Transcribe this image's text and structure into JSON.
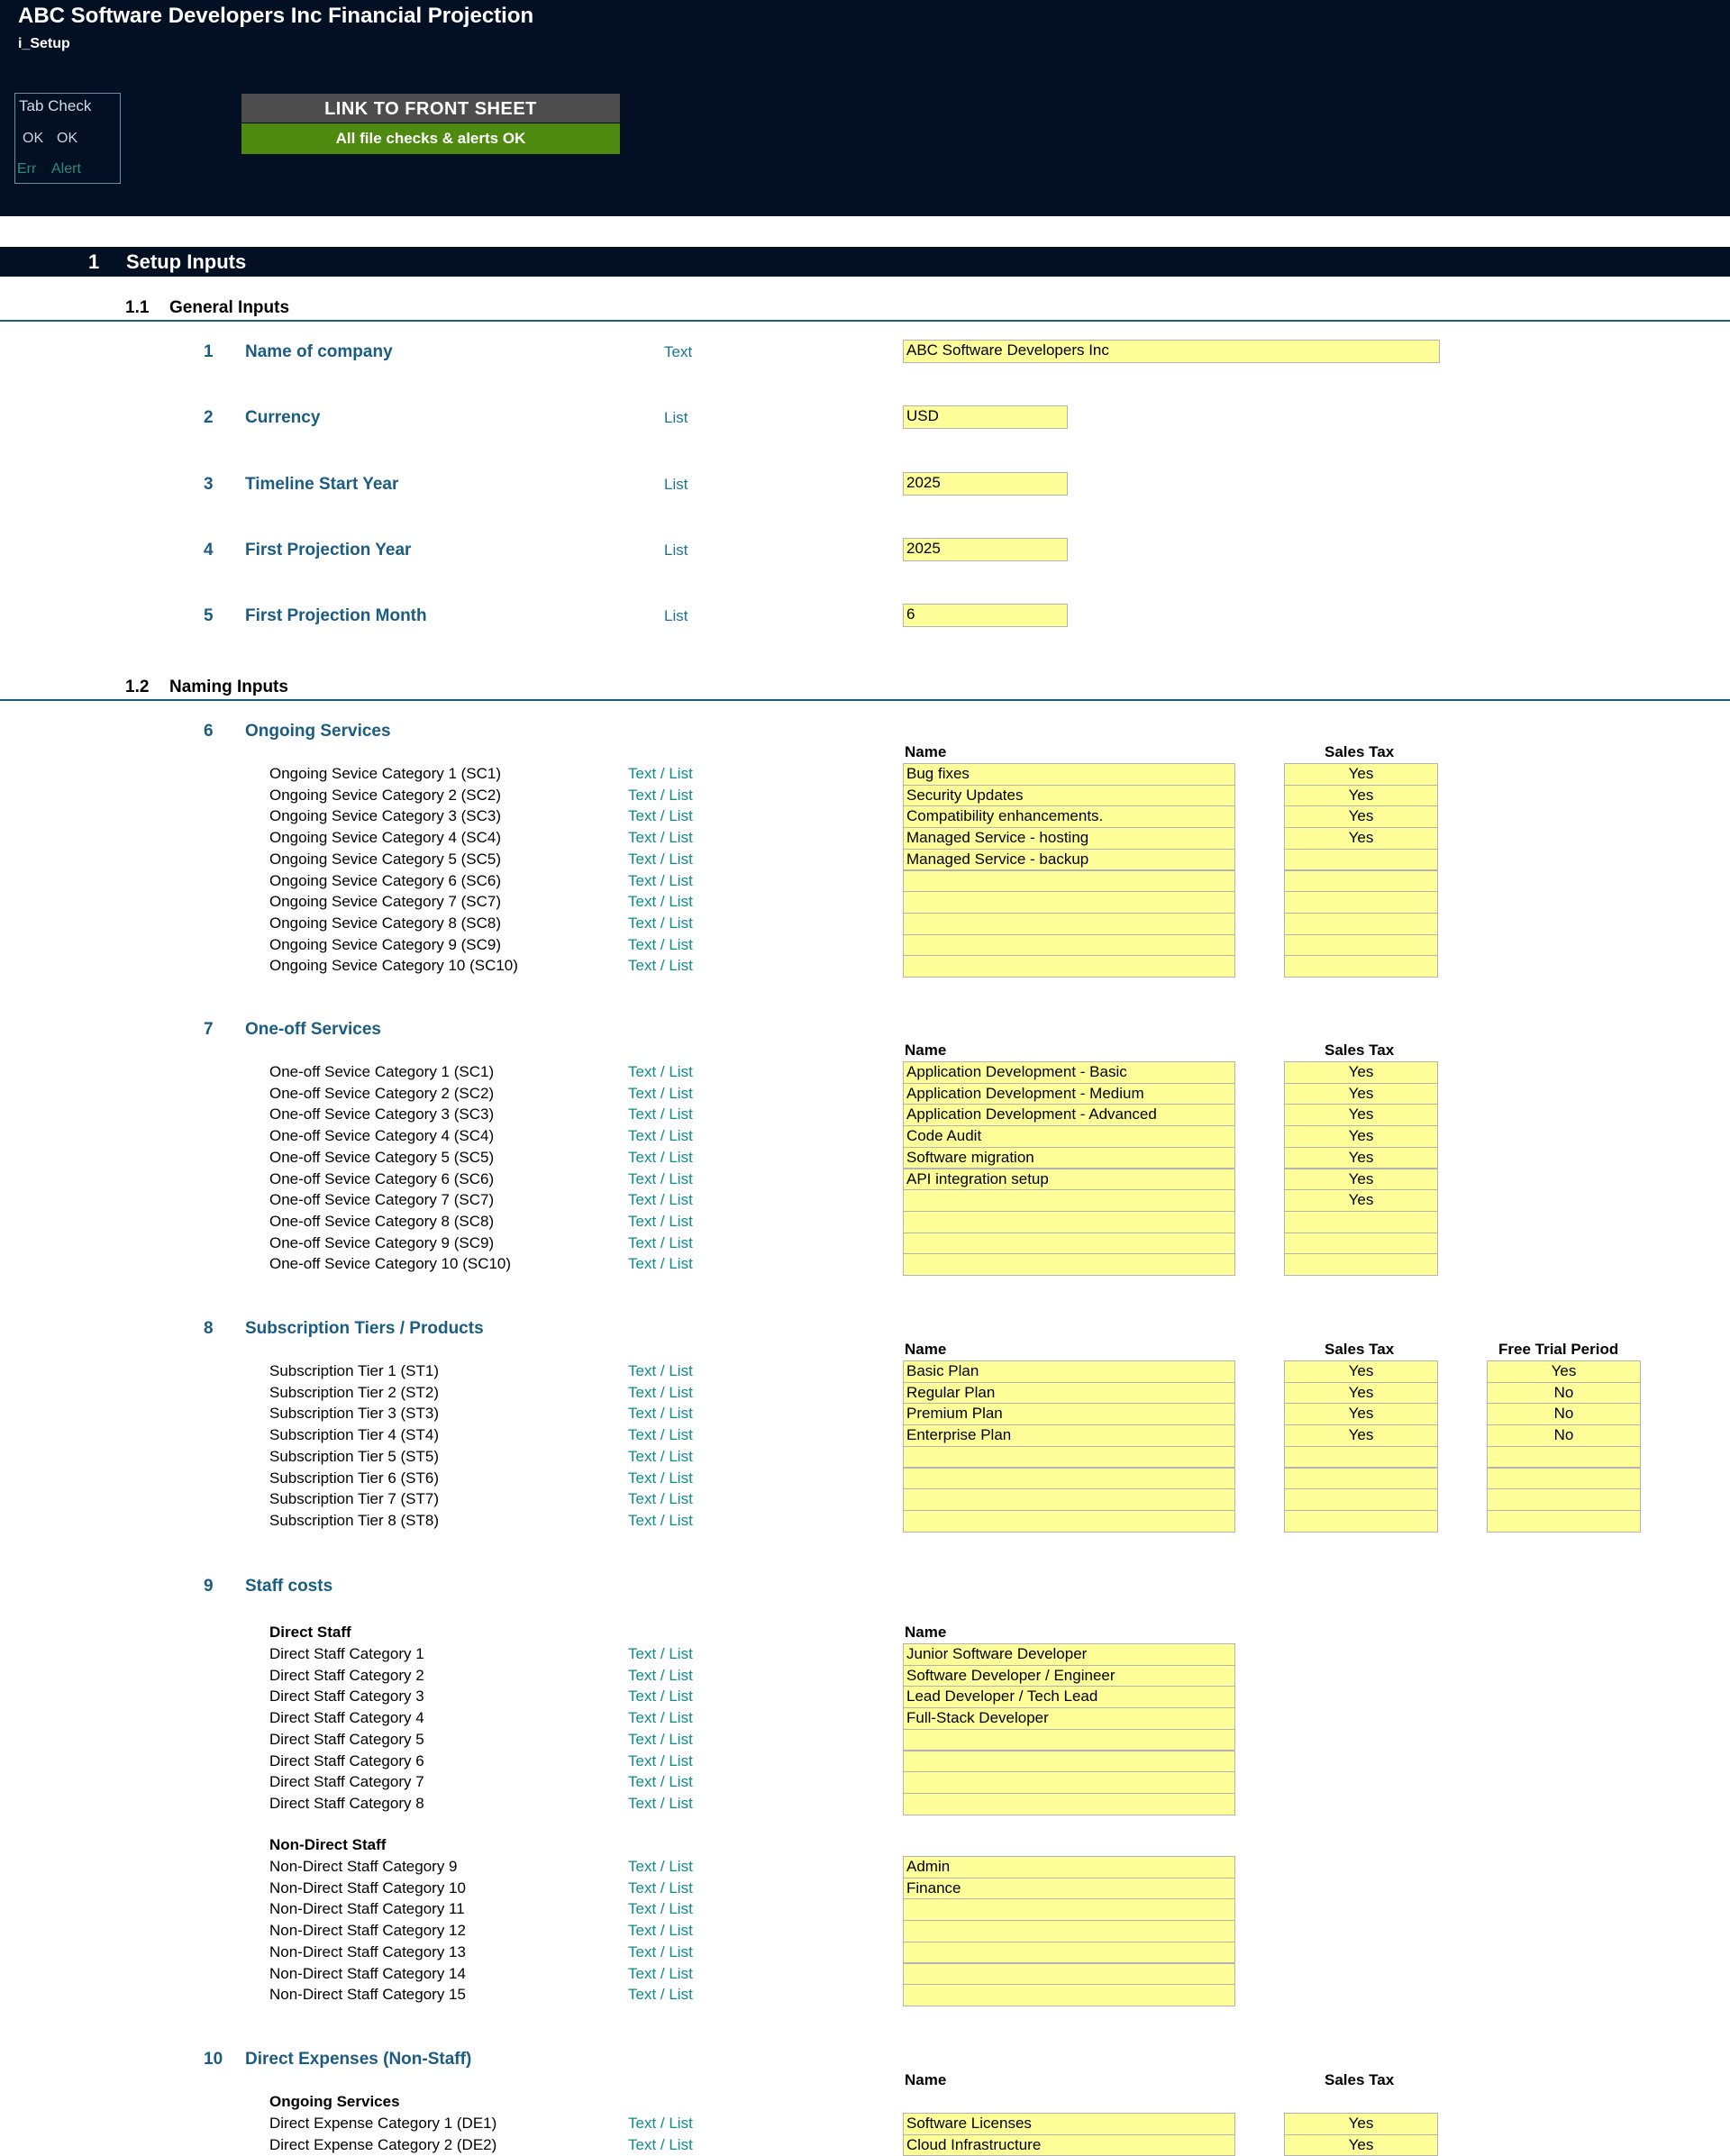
{
  "header": {
    "title": "ABC Software Developers Inc Financial Projection",
    "sheet": "i_Setup",
    "tab_check": {
      "title": "Tab Check",
      "ok1": "OK",
      "ok2": "OK",
      "err": "Err",
      "alert": "Alert"
    },
    "link_button": "LINK TO FRONT SHEET",
    "status": "All file checks & alerts OK"
  },
  "section": {
    "number": "1",
    "title": "Setup Inputs"
  },
  "general": {
    "number": "1.1",
    "title": "General Inputs",
    "items": [
      {
        "num": "1",
        "label": "Name of company",
        "type": "Text",
        "value": "ABC Software Developers Inc"
      },
      {
        "num": "2",
        "label": "Currency",
        "type": "List",
        "value": "USD"
      },
      {
        "num": "3",
        "label": "Timeline Start Year",
        "type": "List",
        "value": "2025"
      },
      {
        "num": "4",
        "label": "First Projection Year",
        "type": "List",
        "value": "2025"
      },
      {
        "num": "5",
        "label": "First Projection Month",
        "type": "List",
        "value": "6"
      }
    ]
  },
  "naming": {
    "number": "1.2",
    "title": "Naming Inputs"
  },
  "text_list": "Text / List",
  "col_name": "Name",
  "col_sales_tax": "Sales Tax",
  "col_free_trial": "Free Trial Period",
  "ongoing": {
    "num": "6",
    "title": "Ongoing Services",
    "rows": [
      {
        "label": "Ongoing Sevice Category 1 (SC1)",
        "name": "Bug fixes",
        "tax": "Yes"
      },
      {
        "label": "Ongoing Sevice Category 2 (SC2)",
        "name": "Security Updates",
        "tax": "Yes"
      },
      {
        "label": "Ongoing Sevice Category 3 (SC3)",
        "name": "Compatibility enhancements.",
        "tax": "Yes"
      },
      {
        "label": "Ongoing Sevice Category 4 (SC4)",
        "name": "Managed Service - hosting",
        "tax": "Yes"
      },
      {
        "label": "Ongoing Sevice Category 5 (SC5)",
        "name": "Managed Service - backup",
        "tax": ""
      },
      {
        "label": "Ongoing Sevice Category 6 (SC6)",
        "name": "",
        "tax": ""
      },
      {
        "label": "Ongoing Sevice Category 7 (SC7)",
        "name": "",
        "tax": ""
      },
      {
        "label": "Ongoing Sevice Category 8 (SC8)",
        "name": "",
        "tax": ""
      },
      {
        "label": "Ongoing Sevice Category 9 (SC9)",
        "name": "",
        "tax": ""
      },
      {
        "label": "Ongoing Sevice Category 10 (SC10)",
        "name": "",
        "tax": ""
      }
    ]
  },
  "oneoff": {
    "num": "7",
    "title": "One-off Services",
    "rows": [
      {
        "label": "One-off Sevice Category 1 (SC1)",
        "name": "Application Development - Basic",
        "tax": "Yes"
      },
      {
        "label": "One-off Sevice Category 2 (SC2)",
        "name": "Application Development - Medium",
        "tax": "Yes"
      },
      {
        "label": "One-off Sevice Category 3 (SC3)",
        "name": "Application Development - Advanced",
        "tax": "Yes"
      },
      {
        "label": "One-off Sevice Category 4 (SC4)",
        "name": "Code Audit",
        "tax": "Yes"
      },
      {
        "label": "One-off Sevice Category 5 (SC5)",
        "name": "Software migration",
        "tax": "Yes"
      },
      {
        "label": "One-off Sevice Category 6 (SC6)",
        "name": "API integration setup",
        "tax": "Yes"
      },
      {
        "label": "One-off Sevice Category 7 (SC7)",
        "name": "",
        "tax": "Yes"
      },
      {
        "label": "One-off Sevice Category 8 (SC8)",
        "name": "",
        "tax": ""
      },
      {
        "label": "One-off Sevice Category 9 (SC9)",
        "name": "",
        "tax": ""
      },
      {
        "label": "One-off Sevice Category 10 (SC10)",
        "name": "",
        "tax": ""
      }
    ]
  },
  "subscriptions": {
    "num": "8",
    "title": "Subscription Tiers / Products",
    "rows": [
      {
        "label": "Subscription Tier 1 (ST1)",
        "name": "Basic Plan",
        "tax": "Yes",
        "trial": "Yes"
      },
      {
        "label": "Subscription Tier 2 (ST2)",
        "name": "Regular Plan",
        "tax": "Yes",
        "trial": "No"
      },
      {
        "label": "Subscription Tier 3 (ST3)",
        "name": "Premium Plan",
        "tax": "Yes",
        "trial": "No"
      },
      {
        "label": "Subscription Tier 4 (ST4)",
        "name": "Enterprise Plan",
        "tax": "Yes",
        "trial": "No"
      },
      {
        "label": "Subscription Tier 5 (ST5)",
        "name": "",
        "tax": "",
        "trial": ""
      },
      {
        "label": "Subscription Tier 6 (ST6)",
        "name": "",
        "tax": "",
        "trial": ""
      },
      {
        "label": "Subscription Tier 7 (ST7)",
        "name": "",
        "tax": "",
        "trial": ""
      },
      {
        "label": "Subscription Tier 8 (ST8)",
        "name": "",
        "tax": "",
        "trial": ""
      }
    ]
  },
  "staff": {
    "num": "9",
    "title": "Staff costs",
    "direct_title": "Direct Staff",
    "direct": [
      {
        "label": "Direct Staff Category 1",
        "name": "Junior Software Developer"
      },
      {
        "label": "Direct Staff Category 2",
        "name": "Software Developer / Engineer"
      },
      {
        "label": "Direct Staff Category 3",
        "name": "Lead Developer / Tech Lead"
      },
      {
        "label": "Direct Staff Category 4",
        "name": "Full-Stack Developer"
      },
      {
        "label": "Direct Staff Category 5",
        "name": ""
      },
      {
        "label": "Direct Staff Category 6",
        "name": ""
      },
      {
        "label": "Direct Staff Category 7",
        "name": ""
      },
      {
        "label": "Direct Staff Category 8",
        "name": ""
      }
    ],
    "nondirect_title": "Non-Direct Staff",
    "nondirect": [
      {
        "label": "Non-Direct Staff Category 9",
        "name": "Admin"
      },
      {
        "label": "Non-Direct Staff Category 10",
        "name": "Finance"
      },
      {
        "label": "Non-Direct Staff Category 11",
        "name": ""
      },
      {
        "label": "Non-Direct Staff Category 12",
        "name": ""
      },
      {
        "label": "Non-Direct Staff Category 13",
        "name": ""
      },
      {
        "label": "Non-Direct Staff Category 14",
        "name": ""
      },
      {
        "label": "Non-Direct Staff Category 15",
        "name": ""
      }
    ]
  },
  "direct_expenses": {
    "num": "10",
    "title": "Direct Expenses (Non-Staff)",
    "group_title": "Ongoing Services",
    "rows": [
      {
        "label": "Direct Expense Category 1 (DE1)",
        "name": "Software Licenses",
        "tax": "Yes"
      },
      {
        "label": "Direct Expense Category 2 (DE2)",
        "name": "Cloud Infrastructure",
        "tax": "Yes"
      }
    ]
  }
}
